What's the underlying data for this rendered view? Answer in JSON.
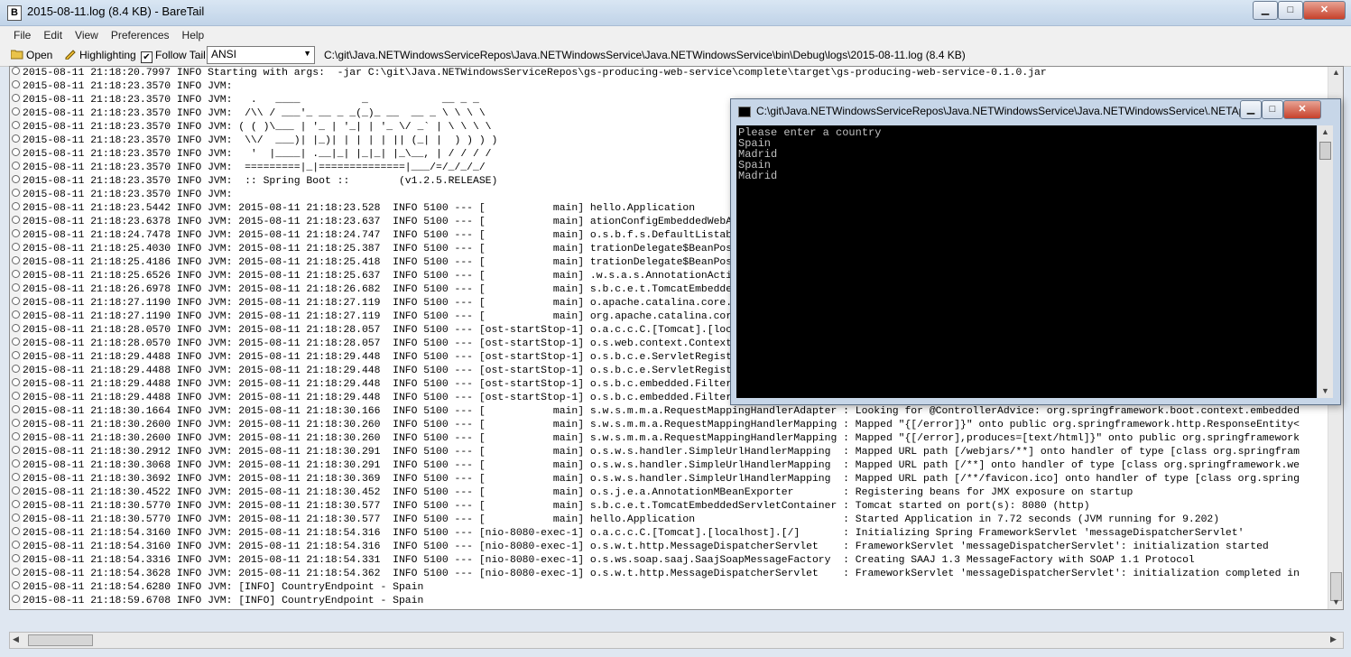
{
  "window": {
    "title": "2015-08-11.log (8.4 KB) - BareTail",
    "app_icon": "baretail-icon",
    "buttons": {
      "minimize": "▁",
      "maximize": "□",
      "close": "✕"
    }
  },
  "menubar": {
    "items": [
      "File",
      "Edit",
      "View",
      "Preferences",
      "Help"
    ]
  },
  "toolbar": {
    "open_label": "Open",
    "highlighting_label": "Highlighting",
    "follow_tail_label": "Follow Tail",
    "follow_tail_checked": true,
    "encoding_value": "ANSI",
    "file_path": "C:\\git\\Java.NETWindowsServiceRepos\\Java.NETWindowsService\\Java.NETWindowsService\\bin\\Debug\\logs\\2015-08-11.log (8.4 KB)"
  },
  "log": {
    "lines": [
      "2015-08-11 21:18:20.7997 INFO Starting with args:  -jar C:\\git\\Java.NETWindowsServiceRepos\\gs-producing-web-service\\complete\\target\\gs-producing-web-service-0.1.0.jar",
      "2015-08-11 21:18:23.3570 INFO JVM:",
      "2015-08-11 21:18:23.3570 INFO JVM:   .   ____          _            __ _ _",
      "2015-08-11 21:18:23.3570 INFO JVM:  /\\\\ / ___'_ __ _ _(_)_ __  __ _ \\ \\ \\ \\",
      "2015-08-11 21:18:23.3570 INFO JVM: ( ( )\\___ | '_ | '_| | '_ \\/ _` | \\ \\ \\ \\",
      "2015-08-11 21:18:23.3570 INFO JVM:  \\\\/  ___)| |_)| | | | | || (_| |  ) ) ) )",
      "2015-08-11 21:18:23.3570 INFO JVM:   '  |____| .__|_| |_|_| |_\\__, | / / / /",
      "2015-08-11 21:18:23.3570 INFO JVM:  =========|_|==============|___/=/_/_/_/",
      "2015-08-11 21:18:23.3570 INFO JVM:  :: Spring Boot ::        (v1.2.5.RELEASE)",
      "2015-08-11 21:18:23.3570 INFO JVM:",
      "2015-08-11 21:18:23.5442 INFO JVM: 2015-08-11 21:18:23.528  INFO 5100 --- [           main] hello.Application",
      "2015-08-11 21:18:23.6378 INFO JVM: 2015-08-11 21:18:23.637  INFO 5100 --- [           main] ationConfigEmbeddedWebApplicationContext",
      "2015-08-11 21:18:24.7478 INFO JVM: 2015-08-11 21:18:24.747  INFO 5100 --- [           main] o.s.b.f.s.DefaultListableBeanFactory",
      "2015-08-11 21:18:25.4030 INFO JVM: 2015-08-11 21:18:25.387  INFO 5100 --- [           main] trationDelegate$BeanPostProcessorChecker",
      "2015-08-11 21:18:25.4186 INFO JVM: 2015-08-11 21:18:25.418  INFO 5100 --- [           main] trationDelegate$BeanPostProcessorChecker",
      "2015-08-11 21:18:25.6526 INFO JVM: 2015-08-11 21:18:25.637  INFO 5100 --- [           main] .w.s.a.s.AnnotationActionEndpointMapping",
      "2015-08-11 21:18:26.6978 INFO JVM: 2015-08-11 21:18:26.682  INFO 5100 --- [           main] s.b.c.e.t.TomcatEmbeddedServletContainer",
      "2015-08-11 21:18:27.1190 INFO JVM: 2015-08-11 21:18:27.119  INFO 5100 --- [           main] o.apache.catalina.core.StandardService",
      "2015-08-11 21:18:27.1190 INFO JVM: 2015-08-11 21:18:27.119  INFO 5100 --- [           main] org.apache.catalina.core.StandardEngine",
      "2015-08-11 21:18:28.0570 INFO JVM: 2015-08-11 21:18:28.057  INFO 5100 --- [ost-startStop-1] o.a.c.c.C.[Tomcat].[localhost].[/]",
      "2015-08-11 21:18:28.0570 INFO JVM: 2015-08-11 21:18:28.057  INFO 5100 --- [ost-startStop-1] o.s.web.context.ContextLoader",
      "2015-08-11 21:18:29.4488 INFO JVM: 2015-08-11 21:18:29.448  INFO 5100 --- [ost-startStop-1] o.s.b.c.e.ServletRegistrationBean",
      "2015-08-11 21:18:29.4488 INFO JVM: 2015-08-11 21:18:29.448  INFO 5100 --- [ost-startStop-1] o.s.b.c.e.ServletRegistrationBean",
      "2015-08-11 21:18:29.4488 INFO JVM: 2015-08-11 21:18:29.448  INFO 5100 --- [ost-startStop-1] o.s.b.c.embedded.FilterRegistrationBean",
      "2015-08-11 21:18:29.4488 INFO JVM: 2015-08-11 21:18:29.448  INFO 5100 --- [ost-startStop-1] o.s.b.c.embedded.FilterRegistrationBean",
      "2015-08-11 21:18:30.1664 INFO JVM: 2015-08-11 21:18:30.166  INFO 5100 --- [           main] s.w.s.m.m.a.RequestMappingHandlerAdapter : Looking for @ControllerAdvice: org.springframework.boot.context.embedded",
      "2015-08-11 21:18:30.2600 INFO JVM: 2015-08-11 21:18:30.260  INFO 5100 --- [           main] s.w.s.m.m.a.RequestMappingHandlerMapping : Mapped \"{[/error]}\" onto public org.springframework.http.ResponseEntity<",
      "2015-08-11 21:18:30.2600 INFO JVM: 2015-08-11 21:18:30.260  INFO 5100 --- [           main] s.w.s.m.m.a.RequestMappingHandlerMapping : Mapped \"{[/error],produces=[text/html]}\" onto public org.springframework",
      "2015-08-11 21:18:30.2912 INFO JVM: 2015-08-11 21:18:30.291  INFO 5100 --- [           main] o.s.w.s.handler.SimpleUrlHandlerMapping  : Mapped URL path [/webjars/**] onto handler of type [class org.springfram",
      "2015-08-11 21:18:30.3068 INFO JVM: 2015-08-11 21:18:30.291  INFO 5100 --- [           main] o.s.w.s.handler.SimpleUrlHandlerMapping  : Mapped URL path [/**] onto handler of type [class org.springframework.we",
      "2015-08-11 21:18:30.3692 INFO JVM: 2015-08-11 21:18:30.369  INFO 5100 --- [           main] o.s.w.s.handler.SimpleUrlHandlerMapping  : Mapped URL path [/**/favicon.ico] onto handler of type [class org.spring",
      "2015-08-11 21:18:30.4522 INFO JVM: 2015-08-11 21:18:30.452  INFO 5100 --- [           main] o.s.j.e.a.AnnotationMBeanExporter        : Registering beans for JMX exposure on startup",
      "2015-08-11 21:18:30.5770 INFO JVM: 2015-08-11 21:18:30.577  INFO 5100 --- [           main] s.b.c.e.t.TomcatEmbeddedServletContainer : Tomcat started on port(s): 8080 (http)",
      "2015-08-11 21:18:30.5770 INFO JVM: 2015-08-11 21:18:30.577  INFO 5100 --- [           main] hello.Application                        : Started Application in 7.72 seconds (JVM running for 9.202)",
      "2015-08-11 21:18:54.3160 INFO JVM: 2015-08-11 21:18:54.316  INFO 5100 --- [nio-8080-exec-1] o.a.c.c.C.[Tomcat].[localhost].[/]       : Initializing Spring FrameworkServlet 'messageDispatcherServlet'",
      "2015-08-11 21:18:54.3160 INFO JVM: 2015-08-11 21:18:54.316  INFO 5100 --- [nio-8080-exec-1] o.s.w.t.http.MessageDispatcherServlet    : FrameworkServlet 'messageDispatcherServlet': initialization started",
      "2015-08-11 21:18:54.3316 INFO JVM: 2015-08-11 21:18:54.331  INFO 5100 --- [nio-8080-exec-1] o.s.ws.soap.saaj.SaajSoapMessageFactory  : Creating SAAJ 1.3 MessageFactory with SOAP 1.1 Protocol",
      "2015-08-11 21:18:54.3628 INFO JVM: 2015-08-11 21:18:54.362  INFO 5100 --- [nio-8080-exec-1] o.s.w.t.http.MessageDispatcherServlet    : FrameworkServlet 'messageDispatcherServlet': initialization completed in",
      "2015-08-11 21:18:54.6280 INFO JVM: [INFO] CountryEndpoint - Spain",
      "2015-08-11 21:18:59.6708 INFO JVM: [INFO] CountryEndpoint - Spain"
    ]
  },
  "console": {
    "title": "C:\\git\\Java.NETWindowsServiceRepos\\Java.NETWindowsService\\Java.NETWindowsService\\.NETAp...",
    "lines": [
      "Please enter a country",
      "Spain",
      "Madrid",
      "Spain",
      "Madrid"
    ]
  },
  "icons": {
    "open": "folder-open-icon",
    "highlighting": "pencil-icon"
  }
}
